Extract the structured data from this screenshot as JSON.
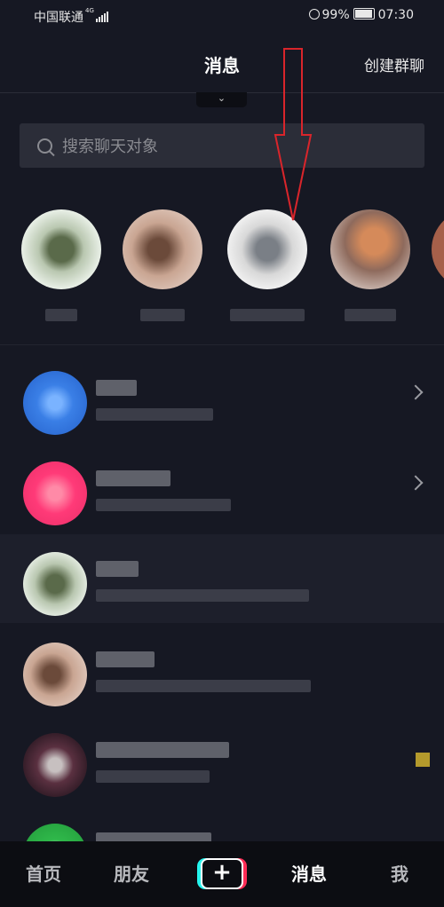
{
  "status": {
    "carrier": "中国联通",
    "network": "4G",
    "battery": "99%",
    "time": "07:30"
  },
  "header": {
    "title": "消息",
    "create_group": "创建群聊"
  },
  "search": {
    "placeholder": "搜索聊天对象"
  },
  "colors": {
    "background": "#161823",
    "accent_red": "#fe2c55",
    "accent_cyan": "#25f4ee",
    "annotation_arrow": "#d9252b"
  },
  "tabs": [
    {
      "label": "首页"
    },
    {
      "label": "朋友"
    },
    {
      "label": "消息"
    },
    {
      "label": "我"
    }
  ]
}
